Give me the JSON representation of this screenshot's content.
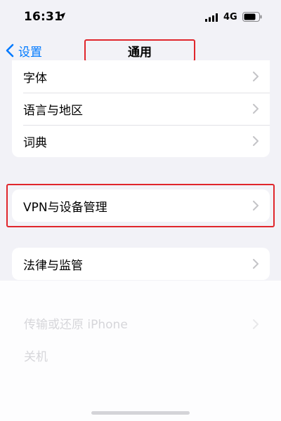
{
  "status_bar": {
    "time": "16:31",
    "network": "4G",
    "icons": [
      "location-arrow-icon",
      "signal-bars-icon",
      "battery-icon"
    ]
  },
  "nav": {
    "back_label": "设置",
    "title": "通用"
  },
  "groups": [
    {
      "items": [
        {
          "label": "字体"
        },
        {
          "label": "语言与地区"
        },
        {
          "label": "词典"
        }
      ]
    },
    {
      "items": [
        {
          "label": "VPN与设备管理"
        }
      ]
    },
    {
      "items": [
        {
          "label": "法律与监管"
        }
      ]
    }
  ],
  "faded_items": [
    {
      "label": "传输或还原 iPhone"
    },
    {
      "label": "关机"
    }
  ],
  "colors": {
    "accent": "#007aff",
    "highlight": "#e0262c",
    "background": "#f2f2f7"
  }
}
